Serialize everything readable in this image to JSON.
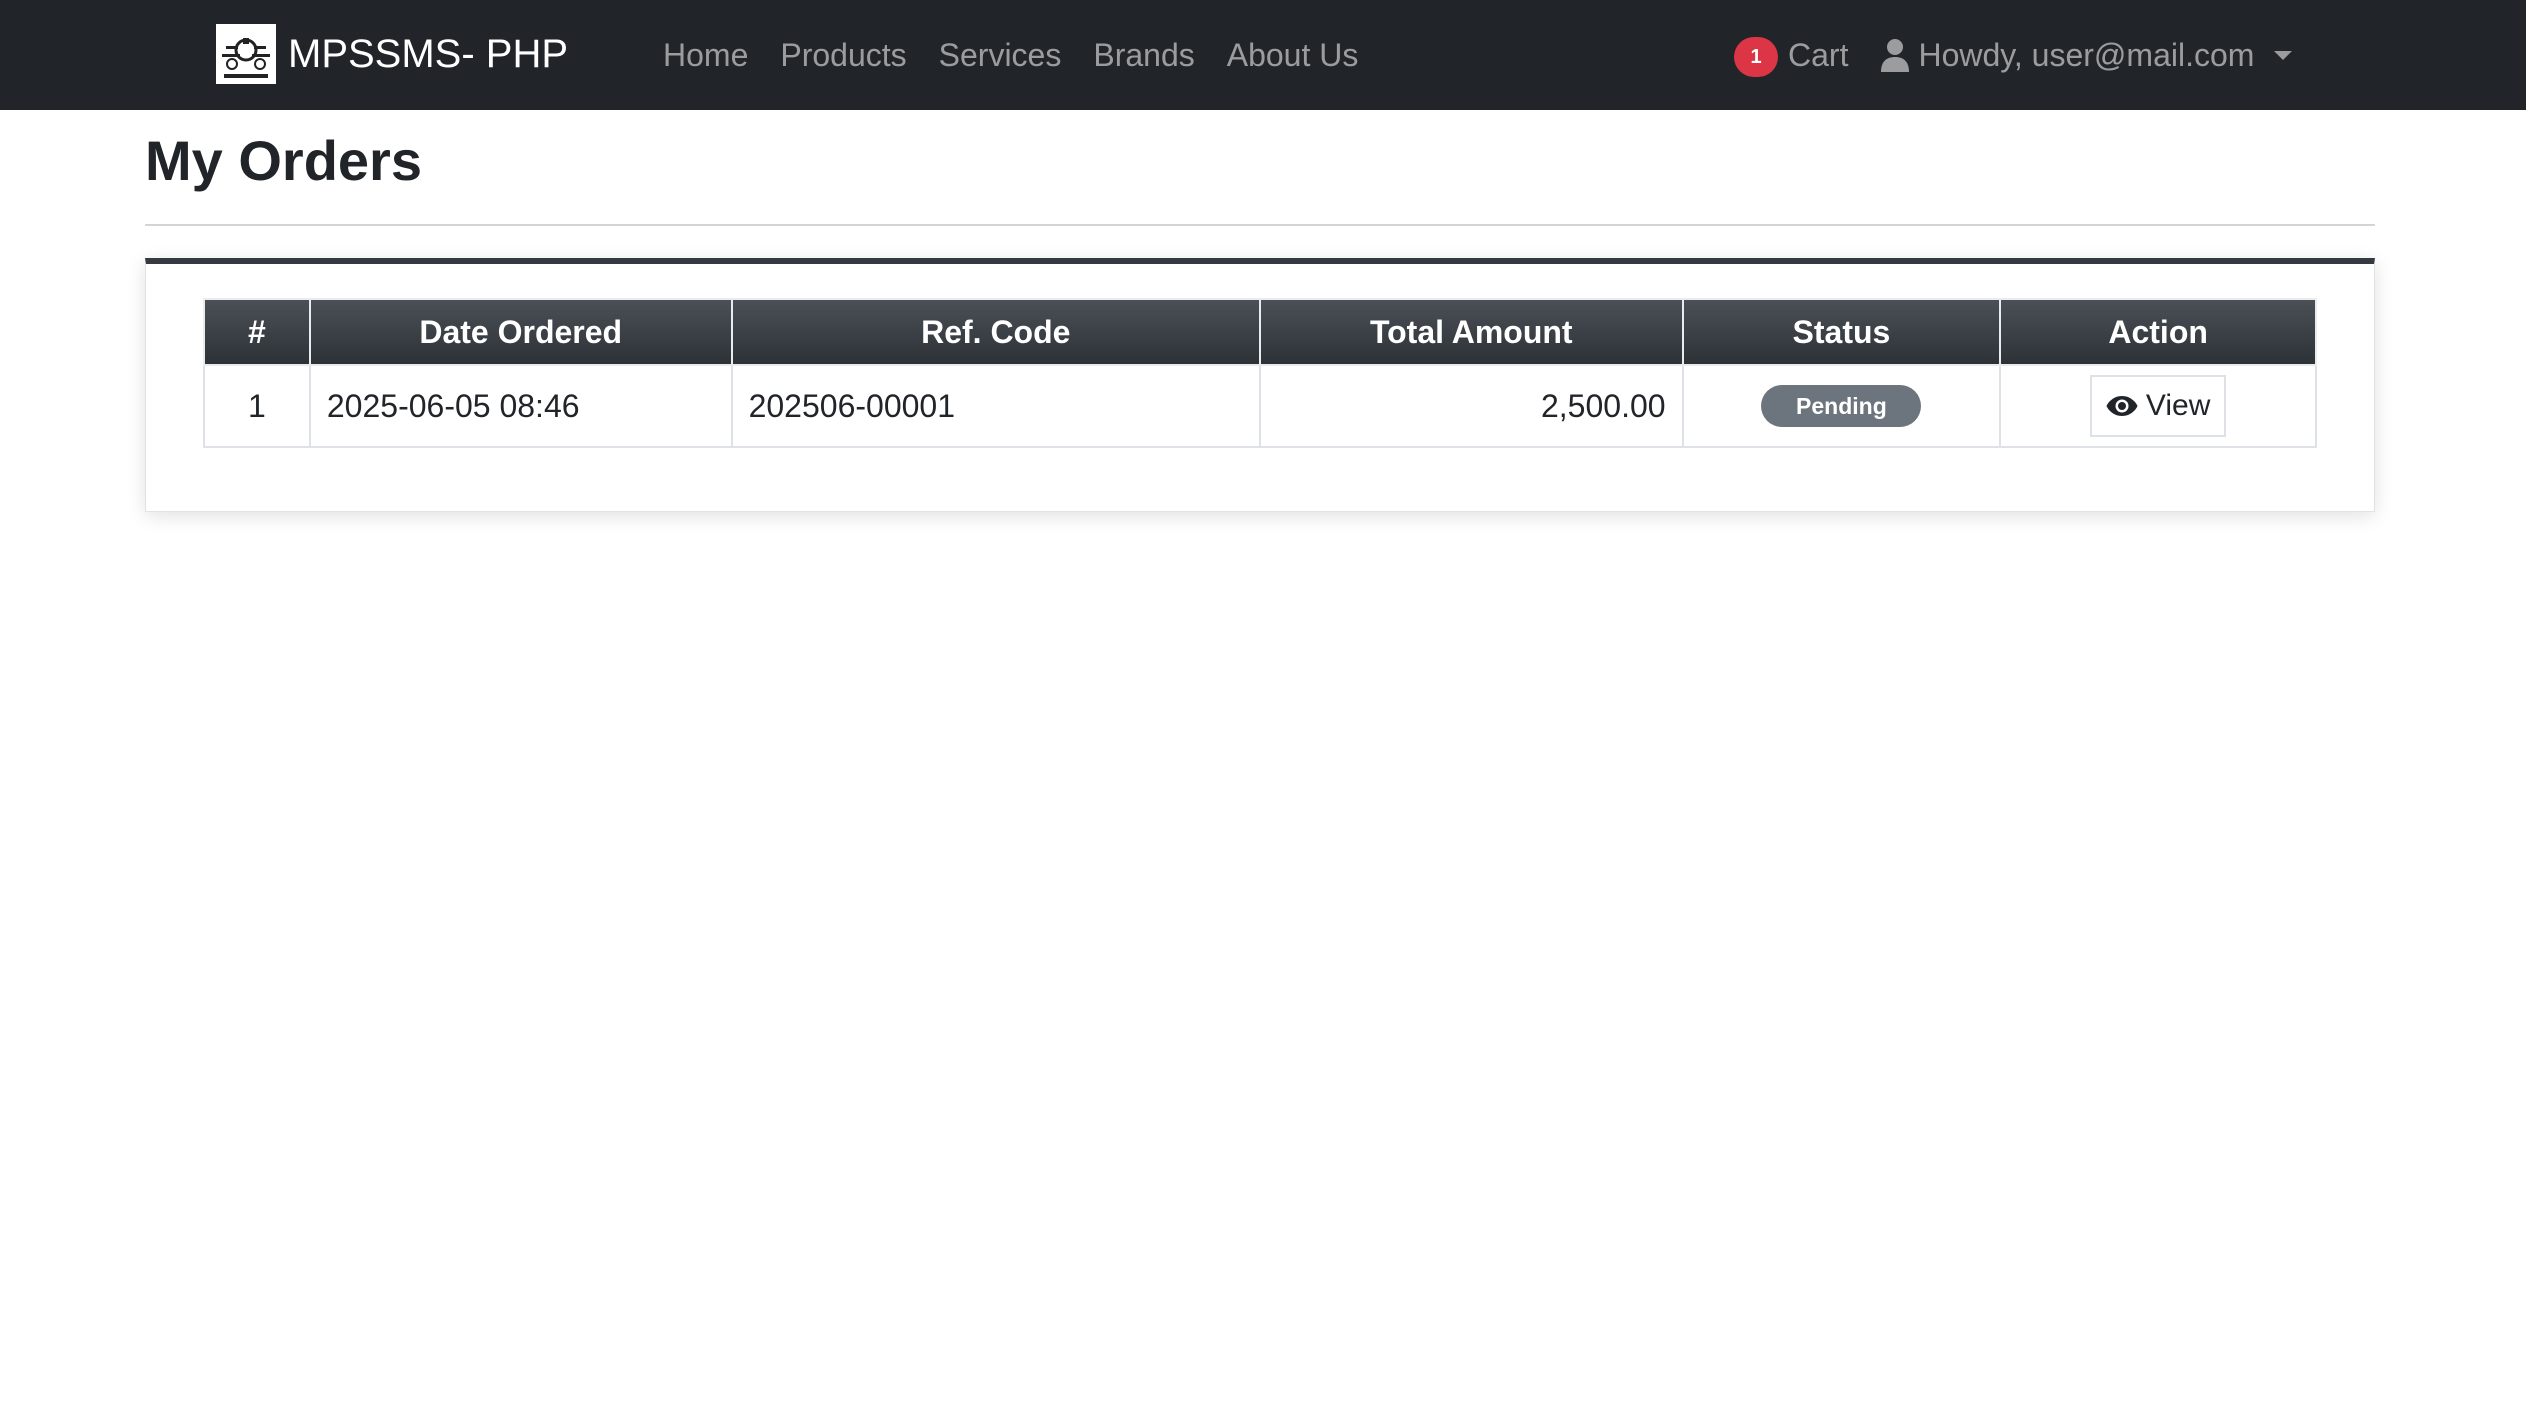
{
  "navbar": {
    "brand_name": "MPSSMS- PHP",
    "links": [
      {
        "label": "Home"
      },
      {
        "label": "Products"
      },
      {
        "label": "Services"
      },
      {
        "label": "Brands"
      },
      {
        "label": "About Us"
      }
    ],
    "cart_count": "1",
    "cart_label": "Cart",
    "user_label": "Howdy, user@mail.com",
    "icons": {
      "logo": "motorcycle-shop-logo",
      "user": "user-icon",
      "dropdown": "caret-down-icon"
    }
  },
  "page": {
    "title": "My Orders"
  },
  "orders_table": {
    "headers": [
      "#",
      "Date Ordered",
      "Ref. Code",
      "Total Amount",
      "Status",
      "Action"
    ],
    "rows": [
      {
        "num": "1",
        "date_ordered": "2025-06-05 08:46",
        "ref_code": "202506-00001",
        "total_amount": "2,500.00",
        "status": "Pending",
        "action_label": "View",
        "action_icon": "eye-icon"
      }
    ]
  },
  "colors": {
    "navbar_bg": "#212529",
    "cart_badge": "#dc3545",
    "status_pending": "#6c757d",
    "card_accent": "#343a40"
  }
}
